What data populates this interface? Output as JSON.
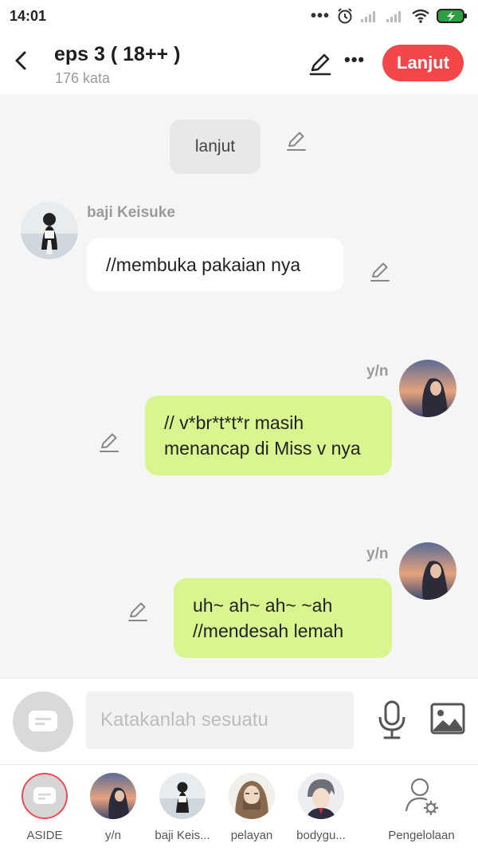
{
  "status_bar": {
    "time": "14:01"
  },
  "header": {
    "title": "eps 3 ( 18++ )",
    "word_count": "176 kata",
    "next_button": "Lanjut"
  },
  "messages": [
    {
      "type": "narration",
      "text": "lanjut"
    },
    {
      "type": "left",
      "speaker": "baji Keisuke",
      "text": "//membuka pakaian nya"
    },
    {
      "type": "right",
      "speaker": "y/n",
      "text": "// v*br*t*t*r masih menancap di Miss v nya"
    },
    {
      "type": "right",
      "speaker": "y/n",
      "text": "uh~ ah~ ah~ ~ah //mendesah lemah"
    }
  ],
  "input": {
    "placeholder": "Katakanlah sesuatu"
  },
  "bottom_bar": {
    "items": [
      {
        "label": "ASIDE"
      },
      {
        "label": "y/n"
      },
      {
        "label": "baji Keis..."
      },
      {
        "label": "pelayan"
      },
      {
        "label": "bodygu..."
      },
      {
        "label": "Pengelolaan"
      }
    ]
  },
  "colors": {
    "accent": "#f2464b",
    "bubble_green": "#d8f58f",
    "bubble_white": "#ffffff",
    "background": "#f5f5f5"
  }
}
